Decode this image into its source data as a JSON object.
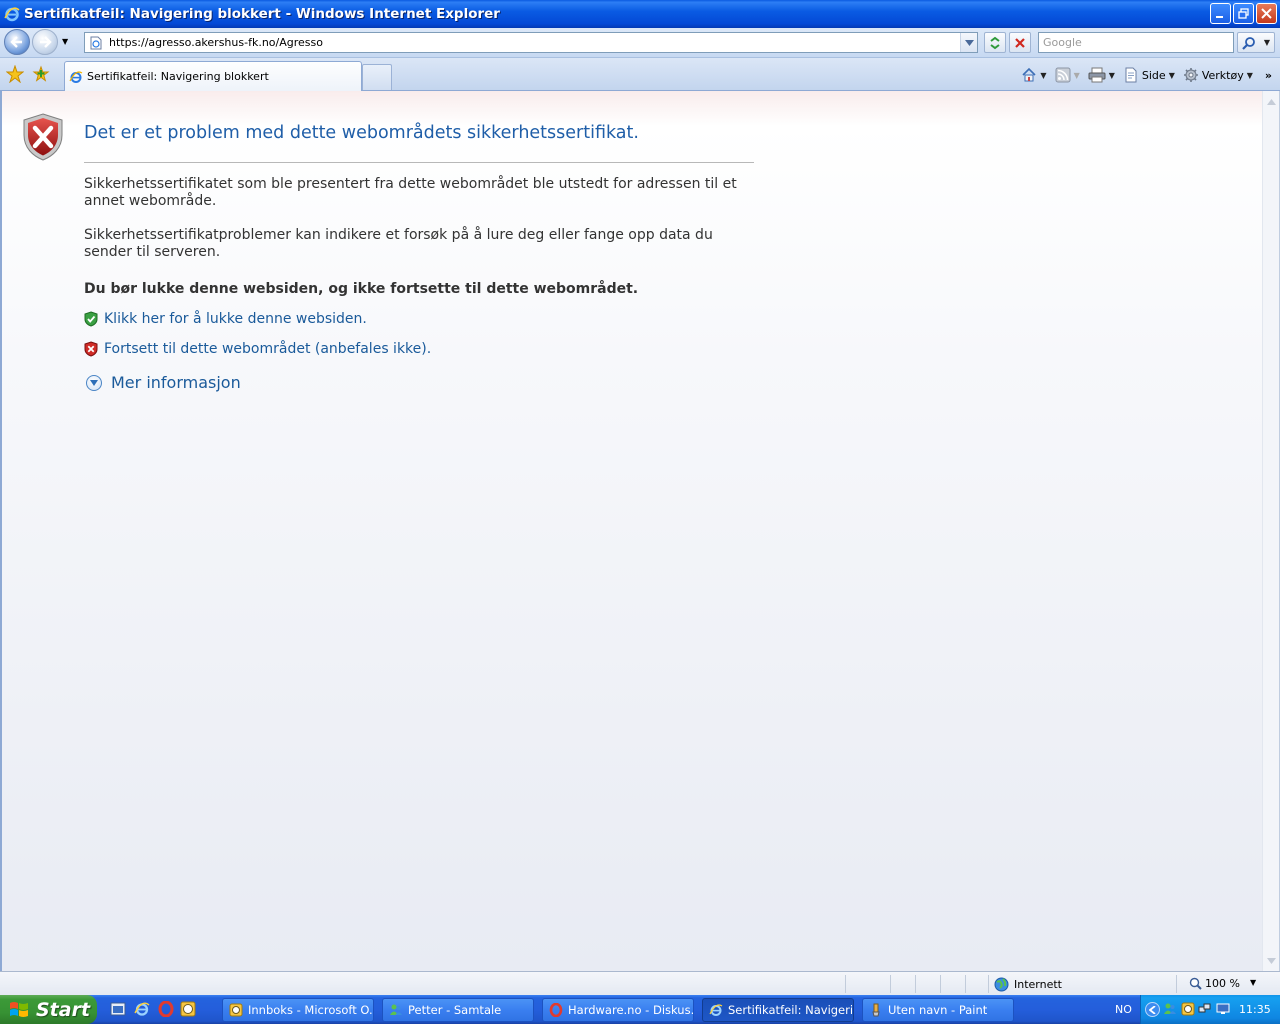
{
  "window": {
    "title": "Sertifikatfeil: Navigering blokkert - Windows Internet Explorer"
  },
  "toolbar": {
    "url": "https://agresso.akershus-fk.no/Agresso",
    "search_placeholder": "Google"
  },
  "tabs": [
    {
      "label": "Sertifikatfeil: Navigering blokkert",
      "active": true
    }
  ],
  "command_bar": {
    "page_label": "Side",
    "tools_label": "Verktøy"
  },
  "page": {
    "heading": "Det er et problem med dette webområdets sikkerhetssertifikat.",
    "paragraph1": "Sikkerhetssertifikatet som ble presentert fra dette webområdet ble utstedt for adressen til et annet webområde.",
    "paragraph2": "Sikkerhetssertifikatproblemer kan indikere et forsøk på å lure deg eller fange opp data du sender til serveren.",
    "recommendation": "Du bør lukke denne websiden, og ikke fortsette til dette webområdet.",
    "close_link": "Klikk her for å lukke denne websiden.",
    "continue_link": "Fortsett til dette webområdet (anbefales ikke).",
    "more_info": "Mer informasjon"
  },
  "status_bar": {
    "zone": "Internett",
    "zoom": "100 %"
  },
  "taskbar": {
    "start_label": "Start",
    "tasks": [
      {
        "label": "Innboks - Microsoft O...",
        "icon": "outlook-icon"
      },
      {
        "label": "Petter - Samtale",
        "icon": "messenger-icon"
      },
      {
        "label": "Hardware.no - Diskus...",
        "icon": "opera-icon"
      },
      {
        "label": "Sertifikatfeil: Navigeri...",
        "icon": "ie-icon",
        "active": true
      },
      {
        "label": "Uten navn - Paint",
        "icon": "paint-icon"
      }
    ],
    "language": "NO",
    "clock": "11:35"
  },
  "colors": {
    "link": "#1a5a9a",
    "heading": "#1f5ea8",
    "xp_blue": "#245edb",
    "start_green": "#379234"
  }
}
